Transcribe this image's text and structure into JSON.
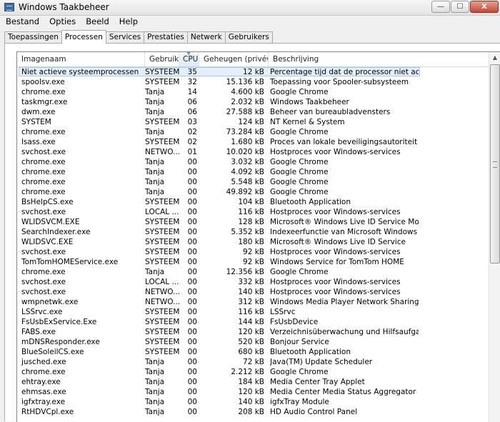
{
  "window": {
    "title": "Windows Taakbeheer",
    "minimize": "—",
    "maximize": "☐",
    "close": "X"
  },
  "menu": [
    "Bestand",
    "Opties",
    "Beeld",
    "Help"
  ],
  "tabs": [
    "Toepassingen",
    "Processen",
    "Services",
    "Prestaties",
    "Netwerk",
    "Gebruikers"
  ],
  "active_tab": "Processen",
  "columns": {
    "name": "Imagenaam",
    "user": "Gebruik...",
    "cpu": "CPU",
    "mem": "Geheugen (privéwe...",
    "desc": "Beschrijving"
  },
  "sorted_column": "CPU",
  "selected_row_index": 0,
  "rows": [
    {
      "name": "Niet actieve systeemprocessen",
      "user": "SYSTEEM",
      "cpu": "35",
      "mem": "12 kB",
      "desc": "Percentage tijd dat de processor niet actief is"
    },
    {
      "name": "spoolsv.exe",
      "user": "SYSTEEM",
      "cpu": "32",
      "mem": "15.136 kB",
      "desc": "Toepassing voor Spooler-subsysteem"
    },
    {
      "name": "chrome.exe",
      "user": "Tanja",
      "cpu": "14",
      "mem": "4.600 kB",
      "desc": "Google Chrome"
    },
    {
      "name": "taskmgr.exe",
      "user": "Tanja",
      "cpu": "06",
      "mem": "2.032 kB",
      "desc": "Windows Taakbeheer"
    },
    {
      "name": "dwm.exe",
      "user": "Tanja",
      "cpu": "06",
      "mem": "27.588 kB",
      "desc": "Beheer van bureaubladvensters"
    },
    {
      "name": "SYSTEM",
      "user": "SYSTEEM",
      "cpu": "03",
      "mem": "124 kB",
      "desc": "NT Kernel & System"
    },
    {
      "name": "chrome.exe",
      "user": "Tanja",
      "cpu": "02",
      "mem": "73.284 kB",
      "desc": "Google Chrome"
    },
    {
      "name": "lsass.exe",
      "user": "SYSTEEM",
      "cpu": "02",
      "mem": "1.680 kB",
      "desc": "Proces van lokale beveiligingsautoriteit"
    },
    {
      "name": "svchost.exe",
      "user": "NETWO...",
      "cpu": "01",
      "mem": "10.020 kB",
      "desc": "Hostproces voor Windows-services"
    },
    {
      "name": "chrome.exe",
      "user": "Tanja",
      "cpu": "00",
      "mem": "3.032 kB",
      "desc": "Google Chrome"
    },
    {
      "name": "chrome.exe",
      "user": "Tanja",
      "cpu": "00",
      "mem": "4.092 kB",
      "desc": "Google Chrome"
    },
    {
      "name": "chrome.exe",
      "user": "Tanja",
      "cpu": "00",
      "mem": "5.548 kB",
      "desc": "Google Chrome"
    },
    {
      "name": "chrome.exe",
      "user": "Tanja",
      "cpu": "00",
      "mem": "49.892 kB",
      "desc": "Google Chrome"
    },
    {
      "name": "BsHelpCS.exe",
      "user": "SYSTEEM",
      "cpu": "00",
      "mem": "104 kB",
      "desc": "Bluetooth Application"
    },
    {
      "name": "svchost.exe",
      "user": "LOCAL ...",
      "cpu": "00",
      "mem": "116 kB",
      "desc": "Hostproces voor Windows-services"
    },
    {
      "name": "WLIDSVCM.EXE",
      "user": "SYSTEEM",
      "cpu": "00",
      "mem": "128 kB",
      "desc": "Microsoft® Windows Live ID Service Monitor"
    },
    {
      "name": "SearchIndexer.exe",
      "user": "SYSTEEM",
      "cpu": "00",
      "mem": "5.352 kB",
      "desc": "Indexeerfunctie van Microsoft Windows Search"
    },
    {
      "name": "WLIDSVC.EXE",
      "user": "SYSTEEM",
      "cpu": "00",
      "mem": "180 kB",
      "desc": "Microsoft® Windows Live ID Service"
    },
    {
      "name": "svchost.exe",
      "user": "SYSTEEM",
      "cpu": "00",
      "mem": "92 kB",
      "desc": "Hostproces voor Windows-services"
    },
    {
      "name": "TomTomHOMEService.exe",
      "user": "SYSTEEM",
      "cpu": "00",
      "mem": "92 kB",
      "desc": "Windows Service for TomTom HOME"
    },
    {
      "name": "chrome.exe",
      "user": "Tanja",
      "cpu": "00",
      "mem": "12.356 kB",
      "desc": "Google Chrome"
    },
    {
      "name": "svchost.exe",
      "user": "LOCAL ...",
      "cpu": "00",
      "mem": "332 kB",
      "desc": "Hostproces voor Windows-services"
    },
    {
      "name": "svchost.exe",
      "user": "NETWO...",
      "cpu": "00",
      "mem": "140 kB",
      "desc": "Hostproces voor Windows-services"
    },
    {
      "name": "wmpnetwk.exe",
      "user": "NETWO...",
      "cpu": "00",
      "mem": "312 kB",
      "desc": "Windows Media Player Network Sharing-service"
    },
    {
      "name": "LSSrvc.exe",
      "user": "SYSTEEM",
      "cpu": "00",
      "mem": "116 kB",
      "desc": "LSSrvc"
    },
    {
      "name": "FsUsbExService.Exe",
      "user": "SYSTEEM",
      "cpu": "00",
      "mem": "144 kB",
      "desc": "FsUsbDevice"
    },
    {
      "name": "FABS.exe",
      "user": "SYSTEEM",
      "cpu": "00",
      "mem": "120 kB",
      "desc": "Verzeichnisüberwachung und Hilfsaufgaben für d..."
    },
    {
      "name": "mDNSResponder.exe",
      "user": "SYSTEEM",
      "cpu": "00",
      "mem": "520 kB",
      "desc": "Bonjour Service"
    },
    {
      "name": "BlueSoleilCS.exe",
      "user": "SYSTEEM",
      "cpu": "00",
      "mem": "680 kB",
      "desc": "Bluetooth Application"
    },
    {
      "name": "jusched.exe",
      "user": "Tanja",
      "cpu": "00",
      "mem": "72 kB",
      "desc": "Java(TM) Update Scheduler"
    },
    {
      "name": "chrome.exe",
      "user": "Tanja",
      "cpu": "00",
      "mem": "2.212 kB",
      "desc": "Google Chrome"
    },
    {
      "name": "ehtray.exe",
      "user": "Tanja",
      "cpu": "00",
      "mem": "184 kB",
      "desc": "Media Center Tray Applet"
    },
    {
      "name": "ehmsas.exe",
      "user": "Tanja",
      "cpu": "00",
      "mem": "120 kB",
      "desc": "Media Center Media Status Aggregator Service"
    },
    {
      "name": "igfxtray.exe",
      "user": "Tanja",
      "cpu": "00",
      "mem": "140 kB",
      "desc": "igfxTray Module"
    },
    {
      "name": "RtHDVCpl.exe",
      "user": "Tanja",
      "cpu": "00",
      "mem": "208 kB",
      "desc": "HD Audio Control Panel"
    }
  ]
}
